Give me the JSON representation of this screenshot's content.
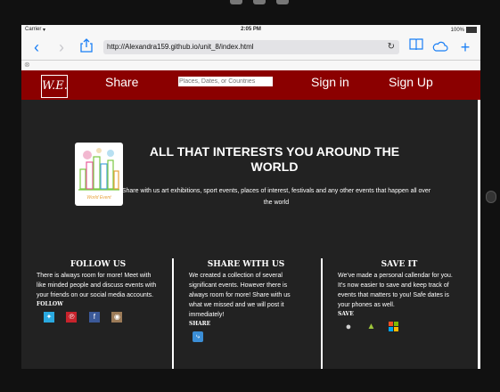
{
  "status": {
    "carrier": "Carrier",
    "time": "2:05 PM",
    "battery": "100%"
  },
  "browser": {
    "url": "http://Alexandra159.github.io/unit_8/index.html"
  },
  "nav": {
    "logo_text": "W.E.",
    "share_label": "Share",
    "search_placeholder": "Places, Dates, or Countries",
    "signin_label": "Sign in",
    "signup_label": "Sign Up"
  },
  "hero": {
    "title": "ALL THAT INTERESTS YOU AROUND THE WORLD",
    "subtitle": "Share with us art exhibitions, sport events, places of interest, festivals and any other events that happen all over the world",
    "image_caption": "World Event"
  },
  "columns": {
    "follow": {
      "title": "FOLLOW US",
      "text": "There is always room for more! Meet with like minded people and discuss events with your friends on our social media accounts.",
      "label": "FOLLOW"
    },
    "share": {
      "title": "SHARE WITH US",
      "text": "We created a collection of several significant events. However there is always room for more! Share with us what we missed and we will post it immediately!",
      "label": "SHARE"
    },
    "save": {
      "title": "SAVE IT",
      "text": "We've made a personal callendar for you. It's now easier to save and keep track of events that matters to you! Safe dates is your phones as well.",
      "label": "SAVE"
    }
  },
  "colors": {
    "nav_bg": "#8b0000",
    "page_bg": "#222222",
    "link_blue": "#1a7ff5"
  }
}
